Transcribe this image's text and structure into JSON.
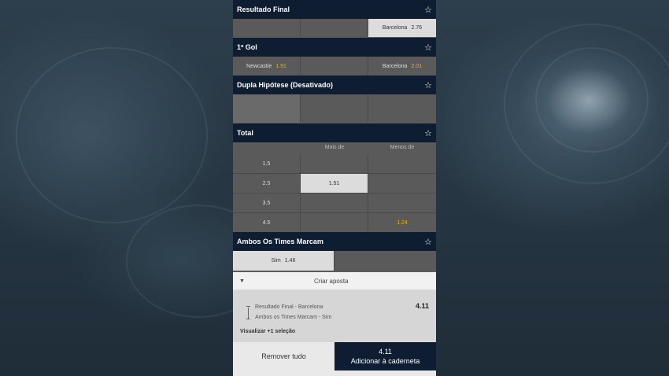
{
  "markets": {
    "resultado_final": {
      "title": "Resultado Final",
      "selection_team": "Barcelona",
      "selection_odd": "2.76"
    },
    "primeiro_gol": {
      "title": "1º Gol",
      "home_team": "Newcastle",
      "home_odd": "1.91",
      "away_team": "Barcelona",
      "away_odd": "2.01"
    },
    "dupla_hipotese": {
      "title": "Dupla Hipótese (Desativado)"
    },
    "total": {
      "title": "Total",
      "col_over": "Mais de",
      "col_under": "Menos de",
      "rows": [
        {
          "line": "1.5",
          "over": "",
          "under": ""
        },
        {
          "line": "2.5",
          "over": "1.51",
          "under": ""
        },
        {
          "line": "3.5",
          "over": "",
          "under": ""
        },
        {
          "line": "4.5",
          "over": "",
          "under": "1.24"
        }
      ]
    },
    "ambos_marcam": {
      "title": "Ambos Os Times Marcam",
      "selection_label": "Sim",
      "selection_odd": "1.46"
    }
  },
  "betslip": {
    "header": "Criar aposta",
    "selections": [
      "Resultado Final - Barcelona",
      "Ambos os Times Marcam - Sim"
    ],
    "total_odds": "4.11",
    "view_more": "Visualizar +1 seleção",
    "remove_all": "Remover tudo",
    "add_odds": "4.11",
    "add_label": "Adicionar à caderneta"
  },
  "colors": {
    "header_bg": "#0f1d33",
    "odd_highlight": "#f0b400",
    "selected_bg": "#dcdcdc"
  }
}
